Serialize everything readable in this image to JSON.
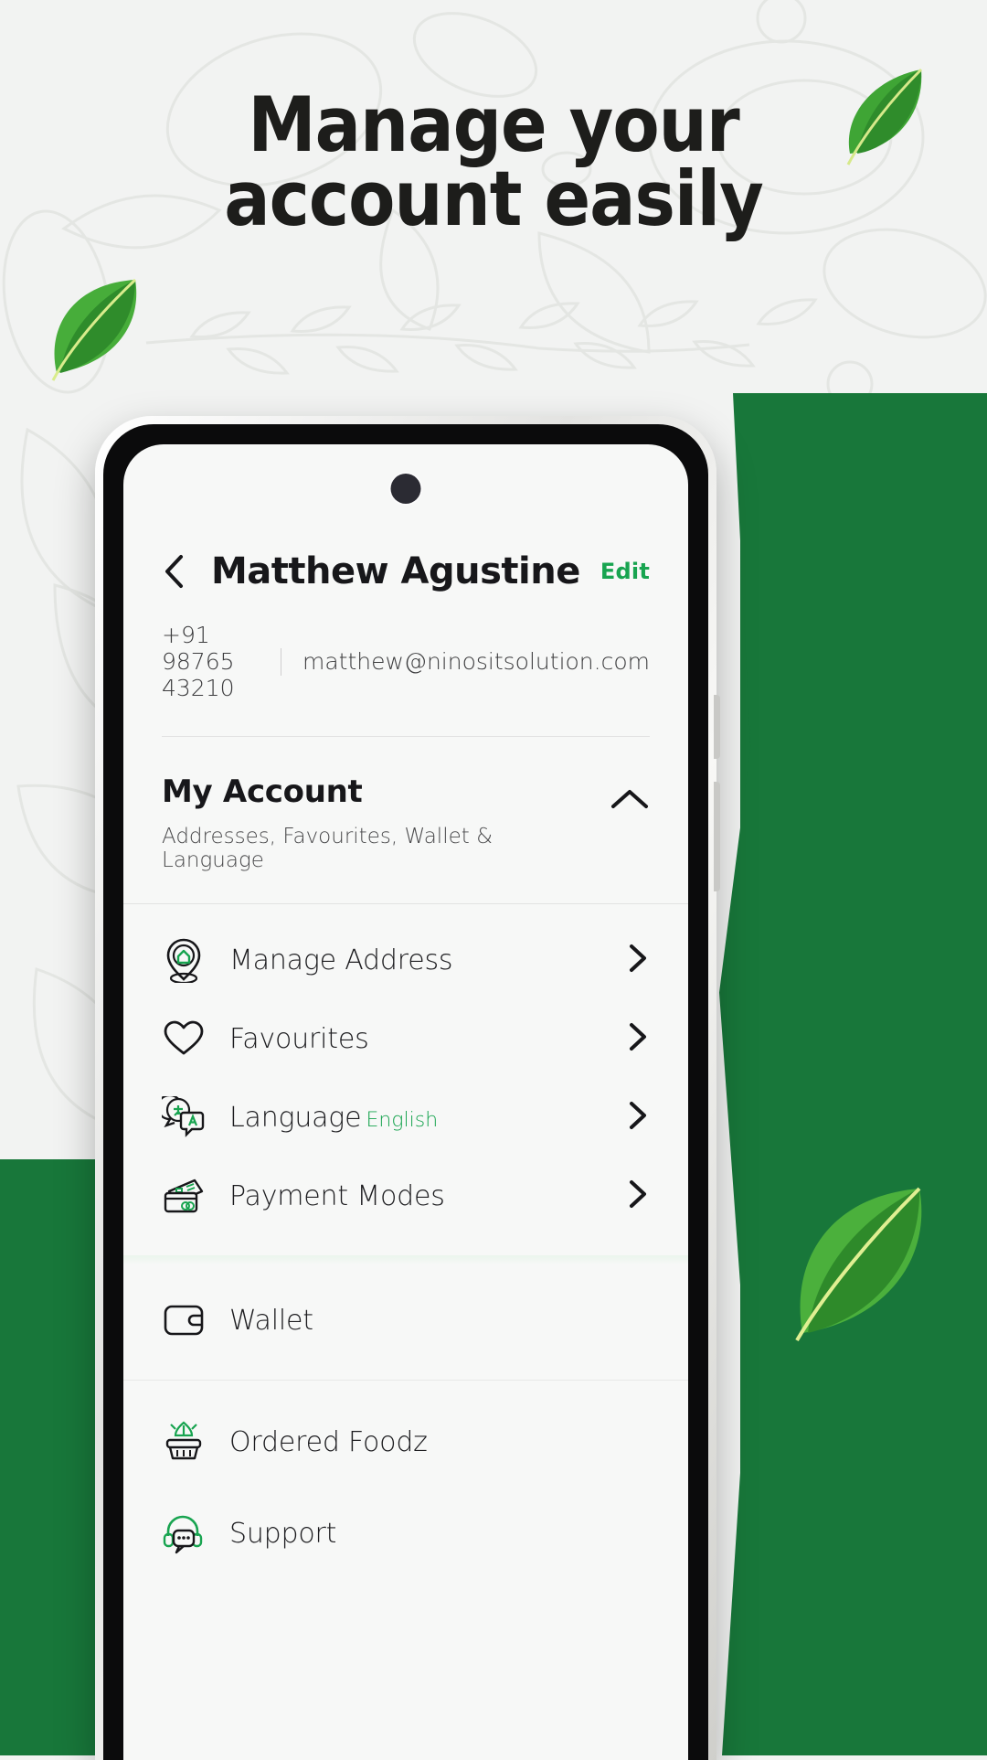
{
  "promo": {
    "headline_line1": "Manage your",
    "headline_line2": "account easily",
    "brand_green": "#18773a",
    "accent_green": "#18a450",
    "page_background": "#f2f3f2"
  },
  "decor": {
    "leaf_top_right": "leaf-icon",
    "leaf_left": "leaf-icon",
    "leaf_bottom_right": "leaf-icon",
    "background_pattern": "herb-line-art"
  },
  "phone": {
    "camera": "front-camera-punch-hole"
  },
  "screen": {
    "header": {
      "back_icon": "chevron-left-icon",
      "name": "Matthew Agustine",
      "edit_label": "Edit",
      "phone": "+91 98765 43210",
      "email": "matthew@ninositsolution.com"
    },
    "accordion": {
      "title": "My Account",
      "subtitle": "Addresses, Favourites, Wallet & Language",
      "chevron": "chevron-up-icon",
      "expanded": true
    },
    "menu_groups": [
      {
        "items": [
          {
            "label": "Manage Address",
            "icon": "location-home-pin-icon",
            "value": "",
            "chevron": "chevron-right-icon"
          },
          {
            "label": "Favourites",
            "icon": "heart-icon",
            "value": "",
            "chevron": "chevron-right-icon"
          },
          {
            "label": "Language",
            "icon": "translate-icon",
            "value": "English",
            "chevron": "chevron-right-icon"
          },
          {
            "label": "Payment Modes",
            "icon": "credit-card-icon",
            "value": "",
            "chevron": "chevron-right-icon"
          }
        ]
      },
      {
        "items": [
          {
            "label": "Wallet",
            "icon": "wallet-icon",
            "value": "",
            "chevron": ""
          }
        ]
      },
      {
        "items": [
          {
            "label": "Ordered Foodz",
            "icon": "food-basket-icon",
            "value": "",
            "chevron": ""
          },
          {
            "label": "Support",
            "icon": "headset-support-icon",
            "value": "",
            "chevron": ""
          }
        ]
      }
    ]
  }
}
